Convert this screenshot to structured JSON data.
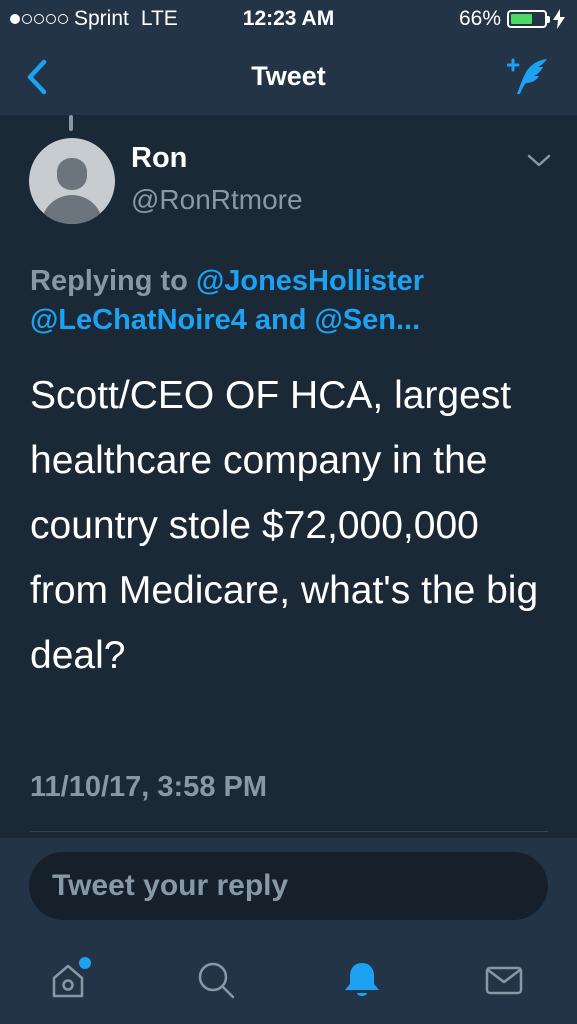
{
  "status_bar": {
    "carrier": "Sprint",
    "network": "LTE",
    "time": "12:23 AM",
    "battery_percent": "66%",
    "battery_level": 0.66,
    "signal_bars_filled": 1,
    "signal_bars_total": 5
  },
  "nav": {
    "title": "Tweet",
    "back_icon": "chevron-left-icon",
    "compose_icon": "compose-tweet-icon"
  },
  "tweet": {
    "display_name": "Ron",
    "handle": "@RonRtmore",
    "replying_prefix": "Replying to",
    "replying_mentions_line1": "@JonesHollister",
    "replying_mentions_line2_a": "@LeChatNoire4",
    "replying_and": "and",
    "replying_mentions_line2_b": "@Sen...",
    "text": "Scott/CEO OF HCA, largest healthcare company in the country stole $72,000,000 from Medicare, what's the big deal?",
    "timestamp": "11/10/17, 3:58 PM"
  },
  "reply": {
    "placeholder": "Tweet your reply"
  },
  "tabs": [
    {
      "name": "home",
      "icon": "home-icon",
      "has_badge": true
    },
    {
      "name": "search",
      "icon": "search-icon",
      "has_badge": false
    },
    {
      "name": "notifications",
      "icon": "bell-icon",
      "active": true
    },
    {
      "name": "messages",
      "icon": "envelope-icon",
      "has_badge": false
    }
  ],
  "colors": {
    "background": "#1b2836",
    "bar": "#243447",
    "accent": "#1da1f2",
    "secondary_text": "#8899a6",
    "battery": "#4cd964"
  }
}
